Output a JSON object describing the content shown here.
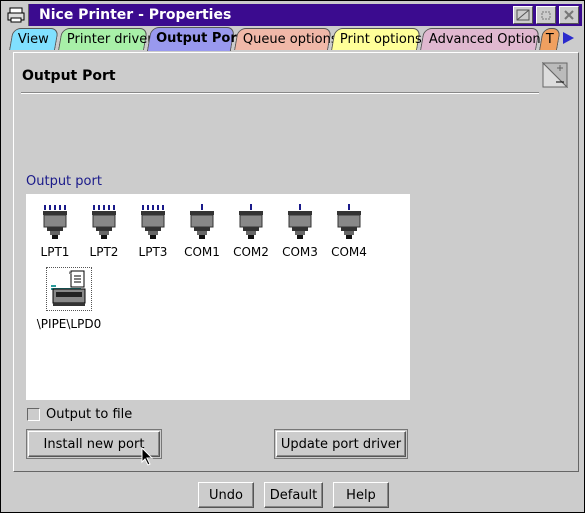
{
  "window": {
    "title": "Nice Printer - Properties"
  },
  "tabs": [
    {
      "label": "View",
      "color": "#80e0ff"
    },
    {
      "label": "Printer driver",
      "color": "#a8f0a8"
    },
    {
      "label": "Output Port",
      "color": "#9999ee"
    },
    {
      "label": "Queue options",
      "color": "#f0b8a8"
    },
    {
      "label": "Print options",
      "color": "#ffff99"
    },
    {
      "label": "Advanced Options",
      "color": "#e0b8d0"
    },
    {
      "label": "T",
      "color": "#f0a060"
    }
  ],
  "page": {
    "title": "Output Port",
    "group_label": "Output port"
  },
  "ports": [
    {
      "label": "LPT1",
      "kind": "parallel"
    },
    {
      "label": "LPT2",
      "kind": "parallel"
    },
    {
      "label": "LPT3",
      "kind": "parallel"
    },
    {
      "label": "COM1",
      "kind": "serial"
    },
    {
      "label": "COM2",
      "kind": "serial"
    },
    {
      "label": "COM3",
      "kind": "serial"
    },
    {
      "label": "COM4",
      "kind": "serial"
    }
  ],
  "pipe_port": {
    "label": "\\PIPE\\LPD0"
  },
  "output_to_file": {
    "label": "Output to file",
    "checked": false
  },
  "buttons": {
    "install": "Install new port",
    "update": "Update port driver",
    "undo": "Undo",
    "default": "Default",
    "help": "Help"
  }
}
